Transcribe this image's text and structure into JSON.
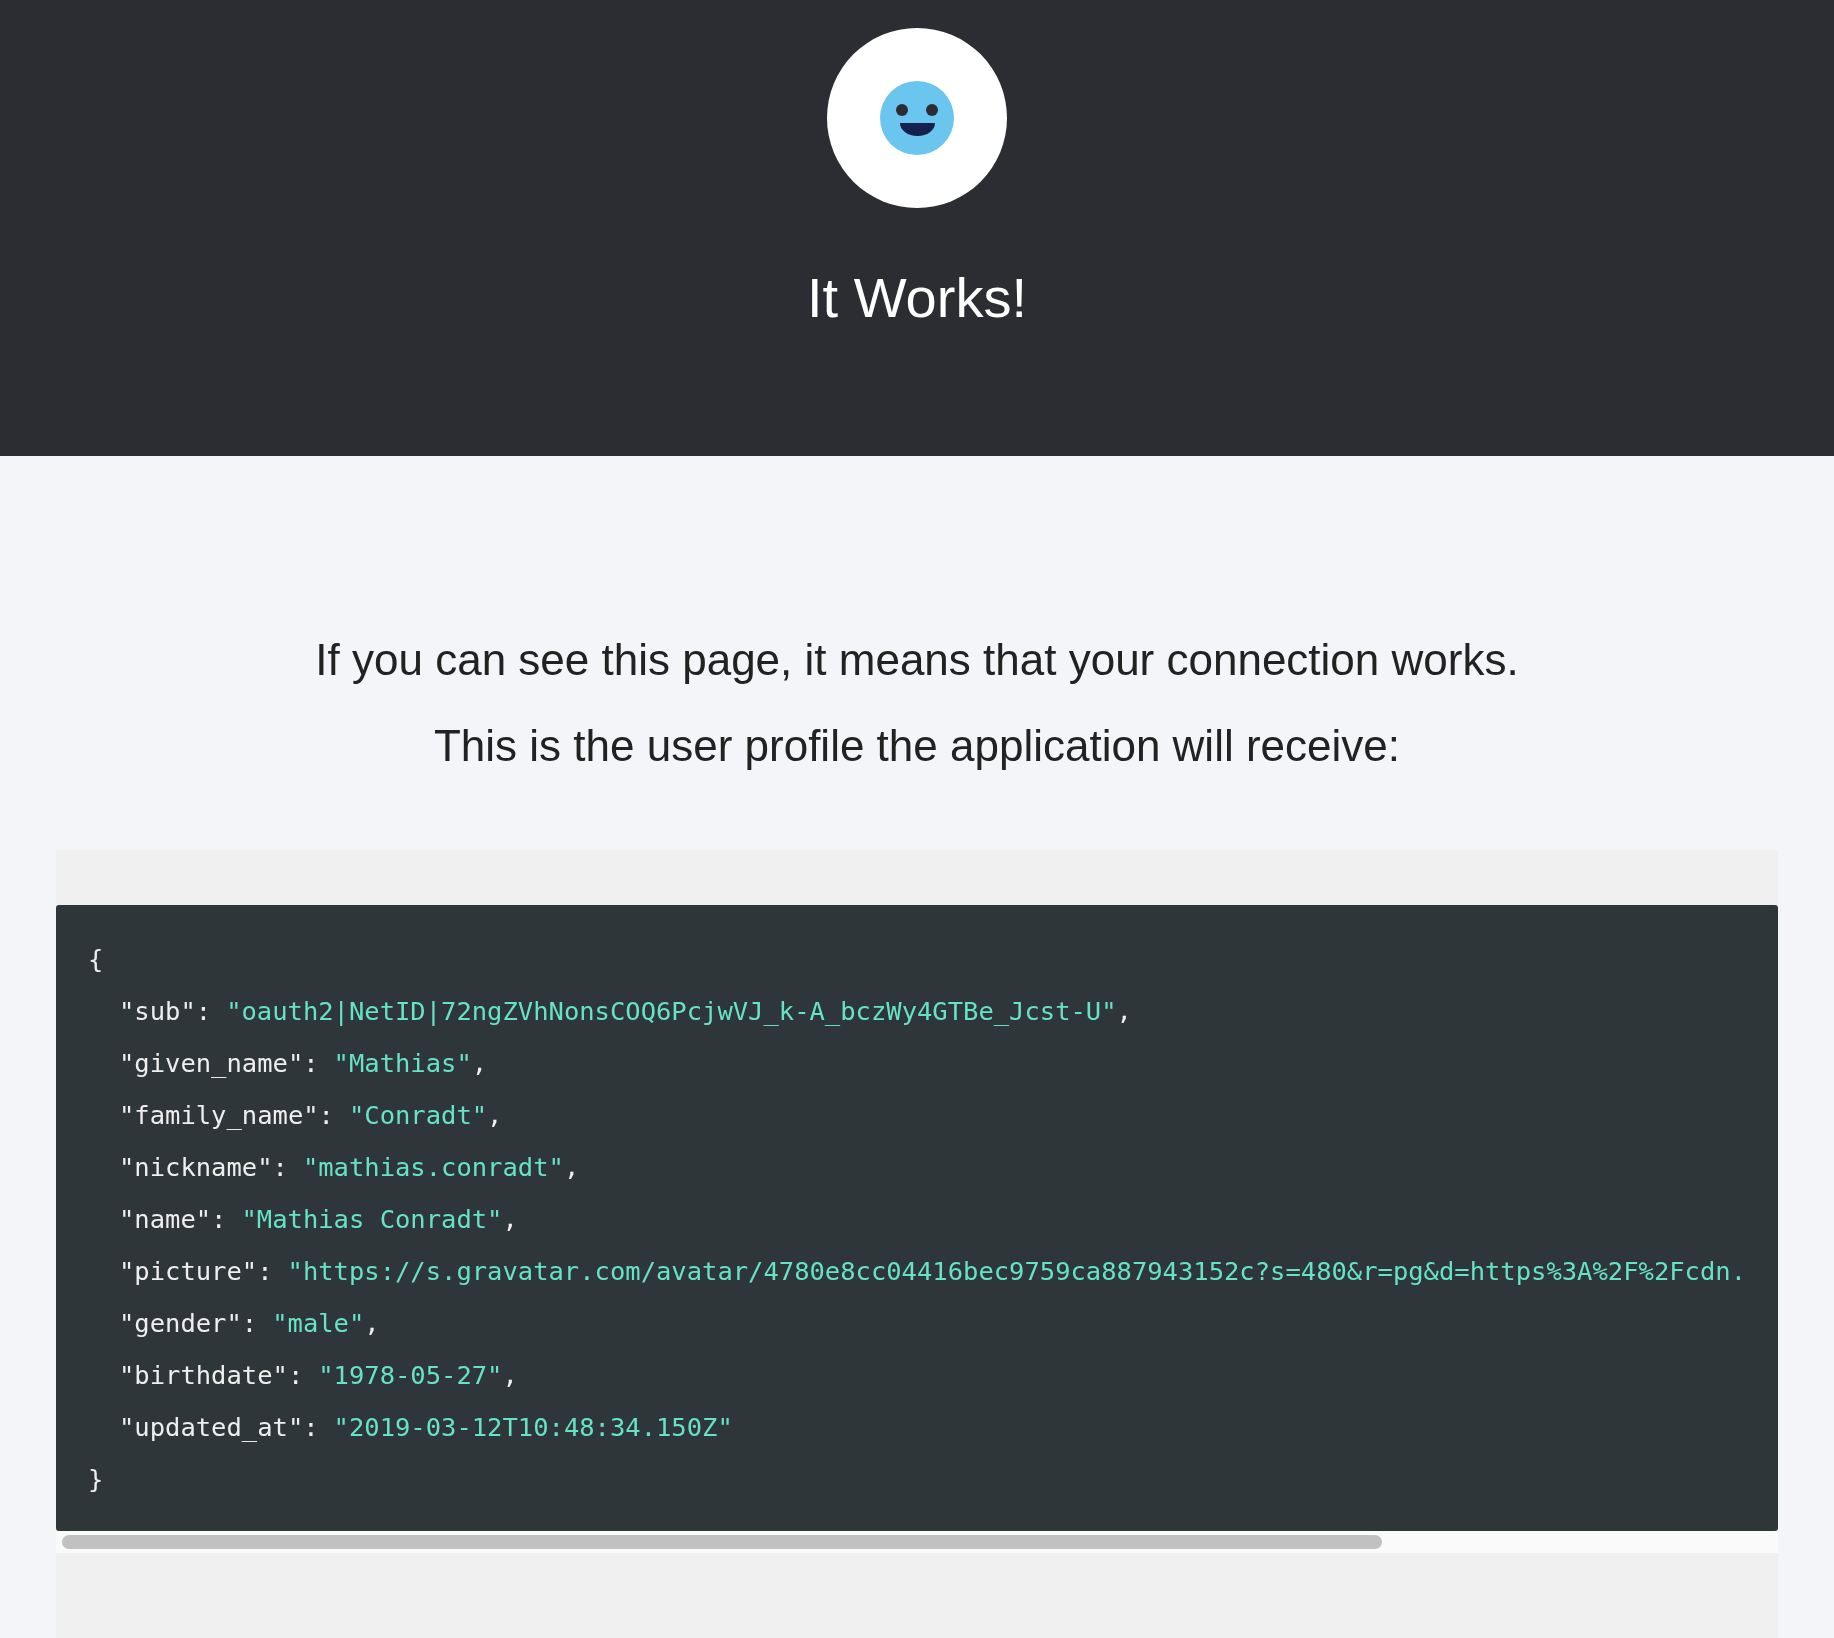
{
  "header": {
    "title": "It Works!"
  },
  "intro": [
    "If you can see this page, it means that your connection works.",
    "This is the user profile the application will receive:"
  ],
  "profile": {
    "open": "{",
    "close": "}",
    "entries": [
      {
        "key": "\"sub\":",
        "value": "\"oauth2|NetID|72ngZVhNonsCOQ6PcjwVJ_k-A_bczWy4GTBe_Jcst-U\"",
        "punct": ","
      },
      {
        "key": "\"given_name\":",
        "value": "\"Mathias\"",
        "punct": ","
      },
      {
        "key": "\"family_name\":",
        "value": "\"Conradt\"",
        "punct": ","
      },
      {
        "key": "\"nickname\":",
        "value": "\"mathias.conradt\"",
        "punct": ","
      },
      {
        "key": "\"name\":",
        "value": "\"Mathias Conradt\"",
        "punct": ","
      },
      {
        "key": "\"picture\":",
        "value": "\"https://s.gravatar.com/avatar/4780e8cc04416bec9759ca887943152c?s=480&r=pg&d=https%3A%2F%2Fcdn."
      },
      {
        "key": "\"gender\":",
        "value": "\"male\"",
        "punct": ","
      },
      {
        "key": "\"birthdate\":",
        "value": "\"1978-05-27\"",
        "punct": ","
      },
      {
        "key": "\"updated_at\":",
        "value": "\"2019-03-12T10:48:34.150Z\""
      }
    ]
  }
}
